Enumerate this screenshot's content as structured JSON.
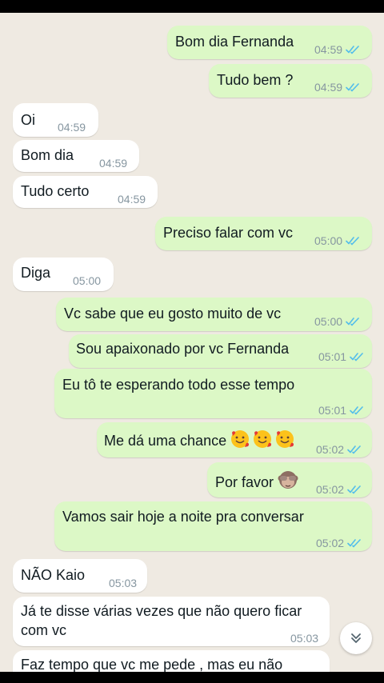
{
  "messages": [
    {
      "text": "Bom dia Fernanda",
      "time": "04:59"
    },
    {
      "text": "Tudo bem ?",
      "time": "04:59"
    },
    {
      "text": "Oi",
      "time": "04:59"
    },
    {
      "text": "Bom dia",
      "time": "04:59"
    },
    {
      "text": "Tudo certo",
      "time": "04:59"
    },
    {
      "text": "Preciso falar com vc",
      "time": "05:00"
    },
    {
      "text": "Diga",
      "time": "05:00"
    },
    {
      "text": "Vc sabe que eu gosto muito de vc",
      "time": "05:00"
    },
    {
      "text": "Sou apaixonado por vc Fernanda",
      "time": "05:01"
    },
    {
      "text": "Eu tô te esperando todo esse tempo",
      "time": "05:01"
    },
    {
      "text": "Me dá uma chance",
      "time": "05:02"
    },
    {
      "text": "Por favor",
      "time": "05:02"
    },
    {
      "text": "Vamos sair hoje a noite pra conversar",
      "time": "05:02"
    },
    {
      "text": "NÃO Kaio",
      "time": "05:03"
    },
    {
      "text": "Já te disse várias vezes que não quero ficar com vc",
      "time": "05:03"
    },
    {
      "text": "Faz tempo que vc me pede , mas eu não"
    }
  ],
  "icons": {
    "read_receipt": "double-check-icon",
    "scroll_down": "chevron-double-down-icon",
    "emoji_love": "smiling-face-with-hearts-icon",
    "emoji_monkey": "see-no-evil-monkey-icon"
  },
  "colors": {
    "outgoing": "#dcf8c6",
    "incoming": "#ffffff",
    "wallpaper": "#efeae2",
    "read_ticks": "#53bdeb",
    "timestamp": "#8696a0"
  }
}
